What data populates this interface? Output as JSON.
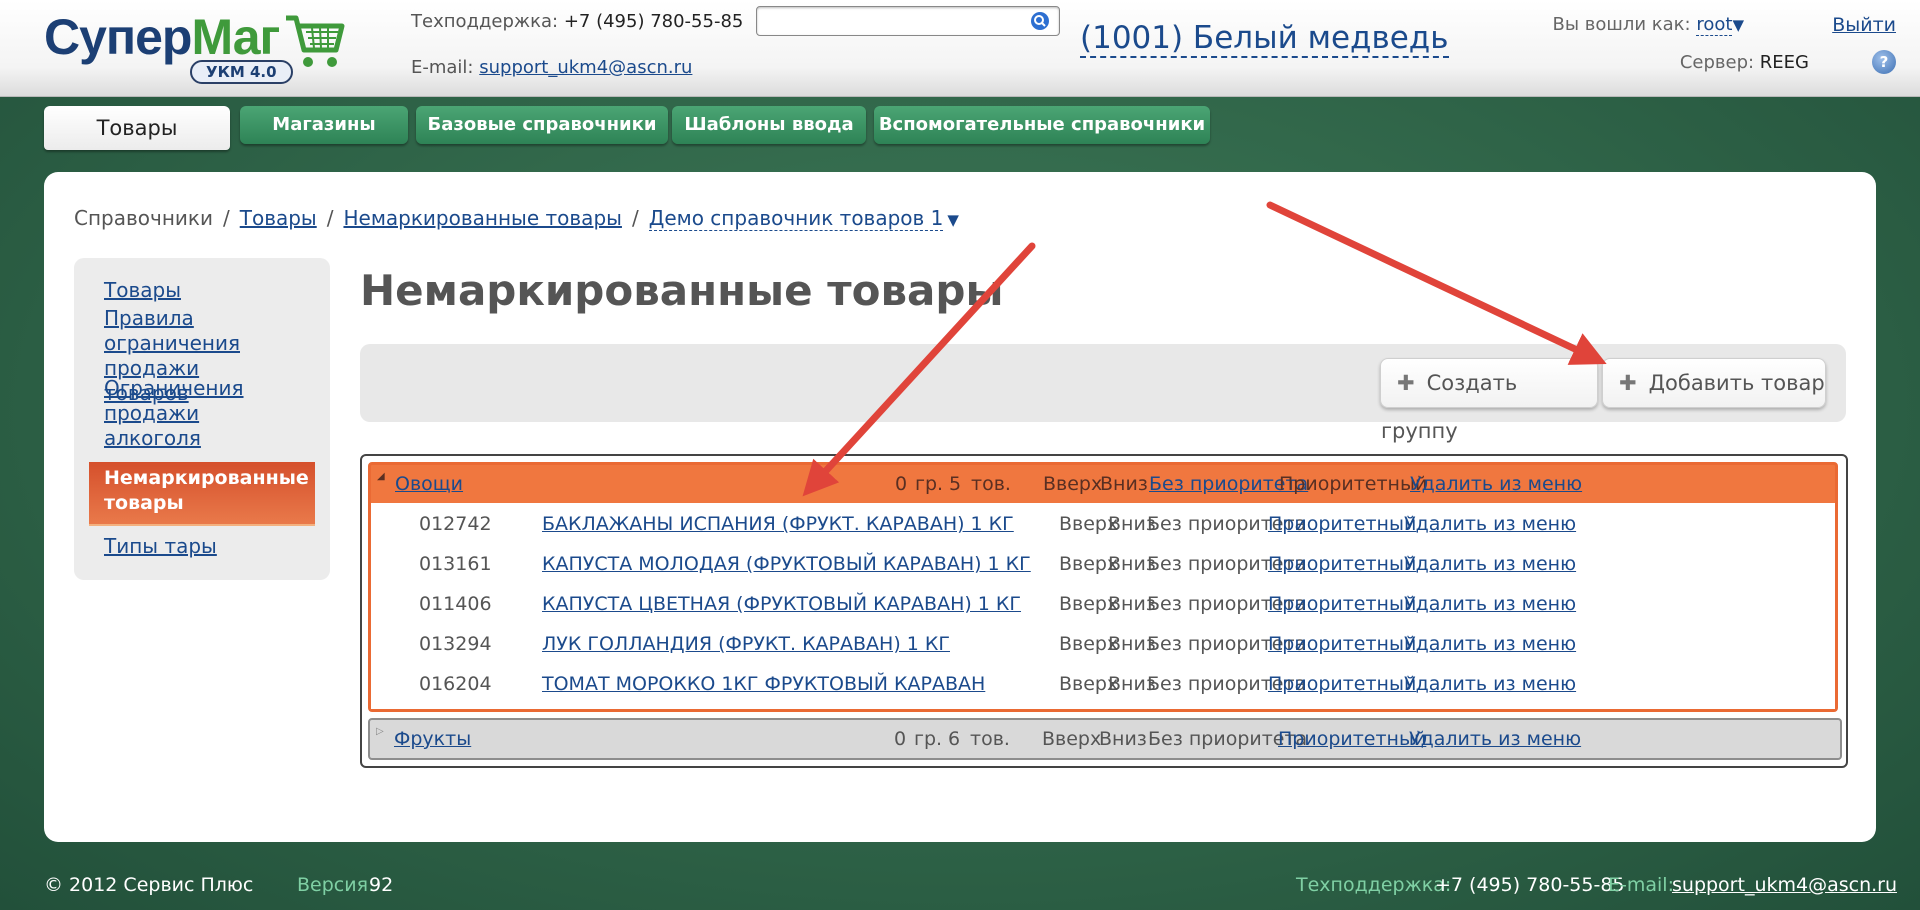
{
  "header": {
    "logo": {
      "word_a": "Супер",
      "word_b": "Маг",
      "badge": "УКМ 4.0"
    },
    "support": {
      "phone_label": "Техподдержка:",
      "phone": "+7 (495) 780-55-85",
      "email_label": "E-mail:",
      "email": "support_ukm4@ascn.ru"
    },
    "search": {
      "value": ""
    },
    "store": "(1001) Белый медведь",
    "user": {
      "label": "Вы вошли как:",
      "name": "root",
      "logout": "Выйти",
      "server_label": "Сервер:",
      "server": "REEG",
      "help": "?"
    }
  },
  "tabs": [
    "Товары",
    "Магазины",
    "Базовые справочники",
    "Шаблоны ввода",
    "Вспомогательные справочники"
  ],
  "breadcrumb": [
    "Справочники",
    "Товары",
    "Немаркированные товары",
    "Демо справочник товаров 1"
  ],
  "sidebar": {
    "items": [
      "Товары",
      "Правила ограничения продажи товаров",
      "Ограничения продажи алкоголя",
      "Немаркированные товары",
      "Типы тары"
    ]
  },
  "page_title": "Немаркированные товары",
  "toolbar": {
    "create_group": "Создать группу",
    "add_item": "Добавить товар"
  },
  "groups": [
    {
      "name": "Овощи",
      "groups_count": "0",
      "groups_unit": "гр.",
      "items_count": "5",
      "items_unit": "тов.",
      "up": "Вверх",
      "down": "Вниз",
      "no_priority": "Без приоритета",
      "priority": "Приоритетный",
      "remove": "Удалить из меню",
      "rows": [
        {
          "code": "012742",
          "name": "БАКЛАЖАНЫ ИСПАНИЯ (ФРУКТ. КАРАВАН) 1 КГ"
        },
        {
          "code": "013161",
          "name": "КАПУСТА МОЛОДАЯ (ФРУКТОВЫЙ КАРАВАН) 1 КГ"
        },
        {
          "code": "011406",
          "name": "КАПУСТА ЦВЕТНАЯ (ФРУКТОВЫЙ КАРАВАН) 1 КГ"
        },
        {
          "code": "013294",
          "name": "ЛУК ГОЛЛАНДИЯ (ФРУКТ. КАРАВАН) 1 КГ"
        },
        {
          "code": "016204",
          "name": "ТОМАТ МОРОККО 1КГ ФРУКТОВЫЙ КАРАВАН"
        }
      ]
    },
    {
      "name": "Фрукты",
      "groups_count": "0",
      "groups_unit": "гр.",
      "items_count": "6",
      "items_unit": "тов.",
      "up": "Вверх",
      "down": "Вниз",
      "no_priority": "Без приоритета",
      "priority": "Приоритетный",
      "remove": "Удалить из меню"
    }
  ],
  "row_actions": {
    "up": "Вверх",
    "down": "Вниз",
    "no_priority": "Без приоритета",
    "priority": "Приоритетный",
    "remove": "Удалить из меню"
  },
  "footer": {
    "copyright": "© 2012 Сервис Плюс",
    "version_label": "Версия:",
    "version": "92",
    "support_label": "Техподдержка:",
    "phone": "+7 (495) 780-55-85",
    "email_label": "E-mail:",
    "email": "support_ukm4@ascn.ru"
  },
  "colors": {
    "accent_green": "#2e8356",
    "accent_orange": "#f0773f",
    "link_blue": "#1b4a8c",
    "arrow_red": "#e0443a"
  }
}
